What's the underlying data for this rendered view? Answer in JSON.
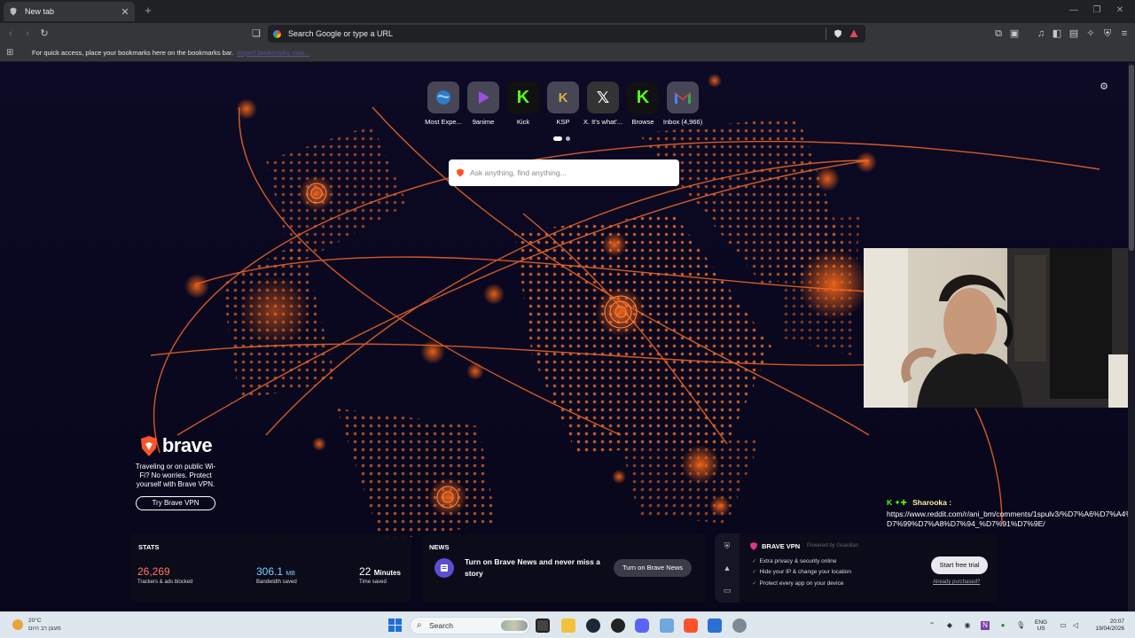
{
  "browser": {
    "tab_title": "New tab",
    "omnibox_placeholder": "Search Google or type a URL",
    "bookmarks_message": "For quick access, place your bookmarks here on the bookmarks bar.",
    "bookmarks_import": "Import bookmarks now..."
  },
  "top_sites": [
    {
      "label": "Most Expe...",
      "icon": "globe-icon",
      "color": "#5aa0d8"
    },
    {
      "label": "9anime",
      "icon": "play-icon",
      "color": "#8a44d8"
    },
    {
      "label": "Kick",
      "icon": "kick-icon",
      "color": "#53fc18"
    },
    {
      "label": "KSP",
      "icon": "ksp-icon",
      "color": "#d4b53a"
    },
    {
      "label": "X. It's what'...",
      "icon": "x-icon",
      "color": "#ffffff"
    },
    {
      "label": "Browse",
      "icon": "kick-icon",
      "color": "#53fc18"
    },
    {
      "label": "Inbox (4,966)",
      "icon": "gmail-icon",
      "color": "#ea4335"
    }
  ],
  "search": {
    "placeholder": "Ask anything, find anything..."
  },
  "promo": {
    "brand": "brave",
    "text": "Traveling or on public Wi-Fi? No worries. Protect yourself with Brave VPN.",
    "button": "Try Brave VPN"
  },
  "chat": {
    "user": "Sharooka :",
    "message": "https://www.reddit.com/r/ani_bm/comments/1spulv3/%D7%A6%D7%A4%D7%99%D7%A8%D7%94_%D7%91%D7%9E/"
  },
  "stats": {
    "title": "STATS",
    "trackers_value": "26,269",
    "trackers_label": "Trackers & ads blocked",
    "bandwidth_value": "306.1",
    "bandwidth_unit": "MB",
    "bandwidth_label": "Bandwidth saved",
    "time_value": "22",
    "time_unit": "Minutes",
    "time_label": "Time saved",
    "trackers_color": "#ff7a5c",
    "bandwidth_color": "#7fd1ff"
  },
  "news": {
    "title": "NEWS",
    "text": "Turn on Brave News and never miss a story",
    "button": "Turn on Brave News"
  },
  "vpn": {
    "title": "BRAVE VPN",
    "powered": "Powered by Guardian",
    "features": [
      "Extra privacy & security online",
      "Hide your IP & change your location",
      "Protect every app on your device"
    ],
    "trial_button": "Start free trial",
    "already": "Already purchased?"
  },
  "taskbar": {
    "weather_temp": "20°C",
    "weather_desc": "מעונן רב היום",
    "search_label": "Search",
    "lang_top": "ENG",
    "lang_bottom": "US",
    "time": "20:07",
    "date": "19/04/2026"
  }
}
